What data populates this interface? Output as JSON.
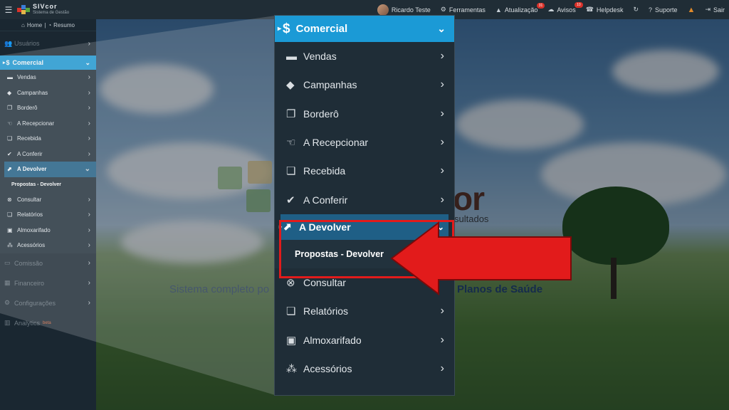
{
  "app": {
    "name": "SIVcor",
    "subtitle": "Sistema de Gestão"
  },
  "topbar": {
    "user": "Ricardo Teste",
    "items": [
      {
        "label": "Ferramentas",
        "icon": "wrench-icon"
      },
      {
        "label": "Atualização",
        "icon": "warning-icon",
        "badge": "31"
      },
      {
        "label": "Avisos",
        "icon": "chat-icon",
        "badge": "10"
      },
      {
        "label": "Helpdesk",
        "icon": "phone-icon"
      },
      {
        "label": "Suporte",
        "icon": "question-icon"
      },
      {
        "label": "Sair",
        "icon": "logout-icon"
      }
    ]
  },
  "sidebar": {
    "home": "Home",
    "resumo": "Resumo",
    "usuarios": "Usuários",
    "comercial": "Comercial",
    "sub": [
      "Vendas",
      "Campanhas",
      "Borderô",
      "A Recepcionar",
      "Recebida",
      "A Conferir"
    ],
    "active": "A Devolver",
    "active_child": "Propostas - Devolver",
    "sub_after": [
      "Consultar",
      "Relatórios",
      "Almoxarifado",
      "Acessórios"
    ],
    "bottom": [
      "Comissão",
      "Financeiro",
      "Configurações",
      "Analytics"
    ],
    "beta": "beta"
  },
  "zoom": {
    "header": "Comercial",
    "items": [
      "Vendas",
      "Campanhas",
      "Borderô",
      "A Recepcionar",
      "Recebida",
      "A Conferir"
    ],
    "active": "A Devolver",
    "active_child": "Propostas - Devolver",
    "items_after": [
      "Consultar",
      "Relatórios",
      "Almoxarifado",
      "Acessórios"
    ]
  },
  "background": {
    "brand": "or",
    "brand_sub": "sultados",
    "tagline_left": "Sistema completo po",
    "tagline_right": "Planos de Saúde"
  },
  "colors": {
    "accent": "#1b9ad6",
    "active": "#1f5f86",
    "highlight": "#e21b1b"
  }
}
